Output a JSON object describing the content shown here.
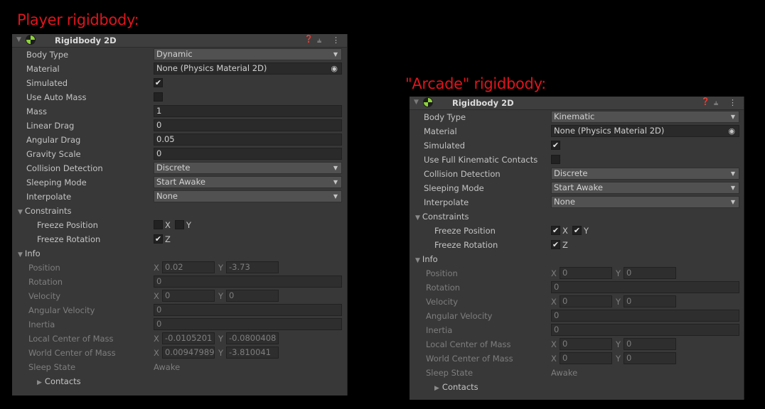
{
  "captions": {
    "player": "Player rigidbody:",
    "arcade": "\"Arcade\" rigidbody:"
  },
  "icons": {
    "fold": "fold-triangle-icon",
    "help": "help-icon",
    "preset": "preset-icon",
    "menu": "kebab-menu-icon",
    "object_picker": "object-picker-icon",
    "check": "checkmark-icon"
  },
  "colors": {
    "caption": "#e0141c",
    "panel": "#383838",
    "component_icon": "#8cd437"
  },
  "player": {
    "component_title": "Rigidbody 2D",
    "labels": {
      "body_type": "Body Type",
      "material": "Material",
      "simulated": "Simulated",
      "use_auto_mass": "Use Auto Mass",
      "mass": "Mass",
      "linear_drag": "Linear Drag",
      "angular_drag": "Angular Drag",
      "gravity_scale": "Gravity Scale",
      "collision_detection": "Collision Detection",
      "sleeping_mode": "Sleeping Mode",
      "interpolate": "Interpolate",
      "constraints": "Constraints",
      "freeze_position": "Freeze Position",
      "freeze_rotation": "Freeze Rotation",
      "info": "Info",
      "position": "Position",
      "rotation": "Rotation",
      "velocity": "Velocity",
      "angular_velocity": "Angular Velocity",
      "inertia": "Inertia",
      "local_com": "Local Center of Mass",
      "world_com": "World Center of Mass",
      "sleep_state": "Sleep State",
      "contacts": "Contacts"
    },
    "values": {
      "body_type": "Dynamic",
      "material": "None (Physics Material 2D)",
      "simulated": true,
      "use_auto_mass": false,
      "mass": "1",
      "linear_drag": "0",
      "angular_drag": "0.05",
      "gravity_scale": "0",
      "collision_detection": "Discrete",
      "sleeping_mode": "Start Awake",
      "interpolate": "None",
      "freeze_pos_x": false,
      "freeze_pos_y": false,
      "freeze_rot_z": true,
      "pos_x": "0.02",
      "pos_y": "-3.73",
      "rotation": "0",
      "vel_x": "0",
      "vel_y": "0",
      "angular_velocity": "0",
      "inertia": "0",
      "local_com_x": "-0.0105201",
      "local_com_y": "-0.0800408",
      "world_com_x": "0.00947989",
      "world_com_y": "-3.810041",
      "sleep_state": "Awake"
    }
  },
  "arcade": {
    "component_title": "Rigidbody 2D",
    "labels": {
      "body_type": "Body Type",
      "material": "Material",
      "simulated": "Simulated",
      "use_full_kinematic": "Use Full Kinematic Contacts",
      "collision_detection": "Collision Detection",
      "sleeping_mode": "Sleeping Mode",
      "interpolate": "Interpolate",
      "constraints": "Constraints",
      "freeze_position": "Freeze Position",
      "freeze_rotation": "Freeze Rotation",
      "info": "Info",
      "position": "Position",
      "rotation": "Rotation",
      "velocity": "Velocity",
      "angular_velocity": "Angular Velocity",
      "inertia": "Inertia",
      "local_com": "Local Center of Mass",
      "world_com": "World Center of Mass",
      "sleep_state": "Sleep State",
      "contacts": "Contacts"
    },
    "values": {
      "body_type": "Kinematic",
      "material": "None (Physics Material 2D)",
      "simulated": true,
      "use_full_kinematic": false,
      "collision_detection": "Discrete",
      "sleeping_mode": "Start Awake",
      "interpolate": "None",
      "freeze_pos_x": true,
      "freeze_pos_y": true,
      "freeze_rot_z": true,
      "pos_x": "0",
      "pos_y": "0",
      "rotation": "0",
      "vel_x": "0",
      "vel_y": "0",
      "angular_velocity": "0",
      "inertia": "0",
      "local_com_x": "0",
      "local_com_y": "0",
      "world_com_x": "0",
      "world_com_y": "0",
      "sleep_state": "Awake"
    }
  },
  "axis": {
    "x": "X",
    "y": "Y",
    "z": "Z"
  }
}
